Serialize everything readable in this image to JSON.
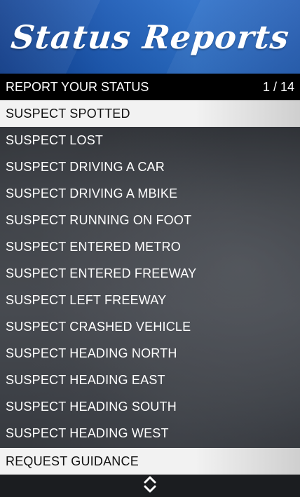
{
  "header": {
    "title": "Status Reports"
  },
  "subheader": {
    "label": "REPORT YOUR STATUS",
    "counter": "1 / 14"
  },
  "items": [
    {
      "label": "SUSPECT SPOTTED",
      "selected": true
    },
    {
      "label": "SUSPECT LOST",
      "selected": false
    },
    {
      "label": "SUSPECT DRIVING A CAR",
      "selected": false
    },
    {
      "label": "SUSPECT DRIVING A MBIKE",
      "selected": false
    },
    {
      "label": "SUSPECT RUNNING ON FOOT",
      "selected": false
    },
    {
      "label": "SUSPECT ENTERED METRO",
      "selected": false
    },
    {
      "label": "SUSPECT ENTERED FREEWAY",
      "selected": false
    },
    {
      "label": "SUSPECT LEFT FREEWAY",
      "selected": false
    },
    {
      "label": "SUSPECT CRASHED VEHICLE",
      "selected": false
    },
    {
      "label": "SUSPECT HEADING NORTH",
      "selected": false
    },
    {
      "label": "SUSPECT HEADING EAST",
      "selected": false
    },
    {
      "label": "SUSPECT HEADING SOUTH",
      "selected": false
    },
    {
      "label": "SUSPECT HEADING WEST",
      "selected": false
    },
    {
      "label": "REQUEST GUIDANCE",
      "selected": true
    }
  ],
  "footer": {
    "icon": "up-down-arrows-icon"
  },
  "colors": {
    "banner_blue": "#1e5cb6",
    "subheader_bg": "#000000",
    "selected_bg": "#f2f2f2",
    "text_light": "#ffffff",
    "text_dark": "#111111"
  }
}
